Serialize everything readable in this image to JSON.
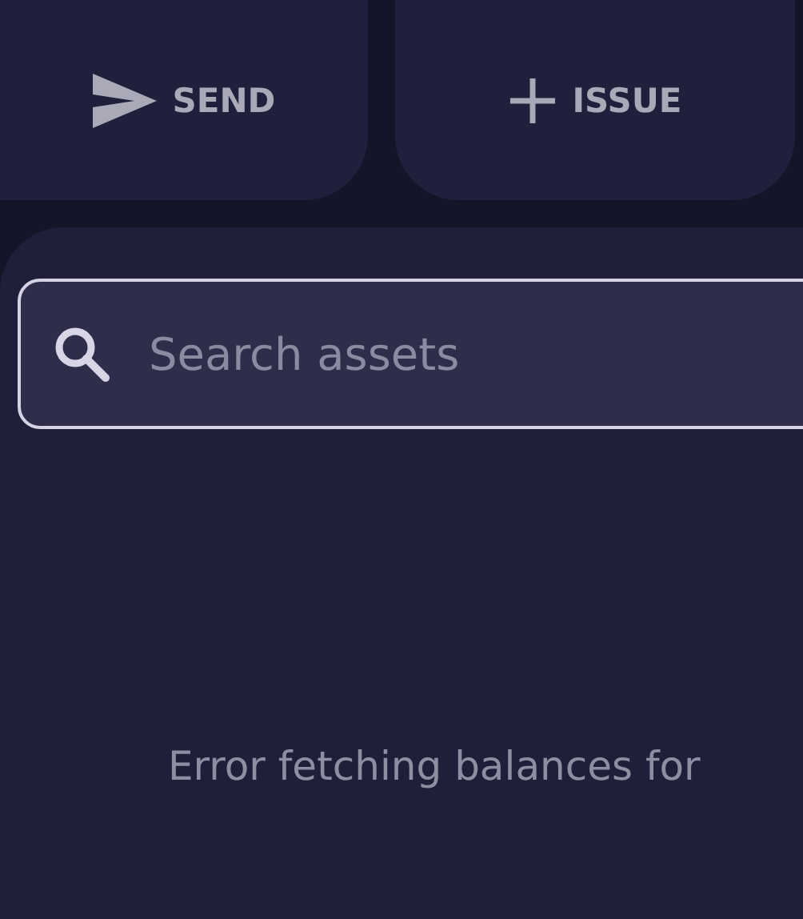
{
  "actions": [
    {
      "kind": "send",
      "label": "SEND"
    },
    {
      "kind": "issue",
      "label": "ISSUE"
    }
  ],
  "search": {
    "placeholder": "Search assets"
  },
  "message": "Error fetching balances for"
}
